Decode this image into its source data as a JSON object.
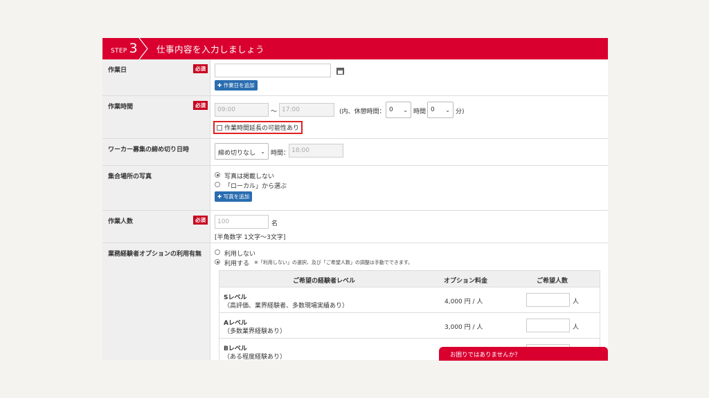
{
  "header": {
    "step_word": "STEP",
    "step_number": "3",
    "title": "仕事内容を入力しましょう"
  },
  "required_label": "必須",
  "work_date": {
    "label": "作業日",
    "value": "",
    "add_button": "作業日を追加",
    "calendar_icon": "calendar-icon"
  },
  "work_time": {
    "label": "作業時間",
    "start_placeholder": "09:00",
    "tilde": "〜",
    "end_placeholder": "17:00",
    "break_prefix": "(内、休憩時間：",
    "hours_value": "0",
    "hours_unit": "時間",
    "minutes_value": "0",
    "minutes_unit": "分)",
    "extension_checkbox": "作業時間延長の可能性あり"
  },
  "deadline": {
    "label": "ワーカー募集の締め切り日時",
    "select_value": "締め切りなし",
    "time_label": "時間：",
    "time_placeholder": "18:00"
  },
  "photo": {
    "label": "集合場所の写真",
    "option_none": "写真は掲載しない",
    "option_local": "「ローカル」から選ぶ",
    "add_button": "写真を追加"
  },
  "headcount": {
    "label": "作業人数",
    "placeholder": "100",
    "unit": "名",
    "hint": "[半角数字 1文字〜3文字]"
  },
  "experience_option": {
    "label": "業務経験者オプションの利用有無",
    "option_no": "利用しない",
    "option_yes": "利用する",
    "note": "※「利用しない」の選択、及び「ご希望人数」の調整は手動でできます。",
    "table_headers": {
      "level": "ご希望の経験者レベル",
      "fee": "オプション料金",
      "count": "ご希望人数"
    },
    "rows": [
      {
        "level": "Sレベル",
        "desc": "（高評価、業界経験者、多数現場実績あり）",
        "price": "4,000 円 / 人",
        "unit": "人"
      },
      {
        "level": "Aレベル",
        "desc": "（多数業界経験あり）",
        "price": "3,000 円 / 人",
        "unit": "人"
      },
      {
        "level": "Bレベル",
        "desc": "（ある程度経験あり）",
        "price": "",
        "unit": ""
      }
    ]
  },
  "help_tab": "お困りではありませんか？",
  "colors": {
    "brand_red": "#d9002f",
    "button_blue": "#2a6db0",
    "label_bg": "#efefef"
  }
}
